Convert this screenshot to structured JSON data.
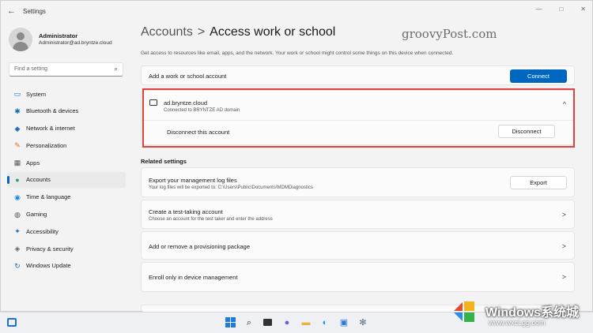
{
  "window": {
    "title": "Settings",
    "back": "←",
    "controls": [
      "—",
      "□",
      "✕"
    ]
  },
  "user": {
    "name": "Administrator",
    "email": "Administrator@ad.bryntze.cloud"
  },
  "search": {
    "placeholder": "Find a setting",
    "icon": "⌕"
  },
  "nav": [
    {
      "label": "System",
      "icon": "monitor-icon",
      "glyph": "▭",
      "color": "#0a6cbd"
    },
    {
      "label": "Bluetooth & devices",
      "icon": "bluetooth-icon",
      "glyph": "✱",
      "color": "#0a6cbd"
    },
    {
      "label": "Network & internet",
      "icon": "wifi-icon",
      "glyph": "◆",
      "color": "#2a6fc4"
    },
    {
      "label": "Personalization",
      "icon": "brush-icon",
      "glyph": "✎",
      "color": "#d06a28"
    },
    {
      "label": "Apps",
      "icon": "apps-icon",
      "glyph": "▦",
      "color": "#555555"
    },
    {
      "label": "Accounts",
      "icon": "person-icon",
      "glyph": "●",
      "color": "#2aa06b",
      "active": true
    },
    {
      "label": "Time & language",
      "icon": "globe-icon",
      "glyph": "◉",
      "color": "#1a8ad6"
    },
    {
      "label": "Gaming",
      "icon": "gamepad-icon",
      "glyph": "◍",
      "color": "#555555"
    },
    {
      "label": "Accessibility",
      "icon": "accessibility-icon",
      "glyph": "✦",
      "color": "#1a6fb8"
    },
    {
      "label": "Privacy & security",
      "icon": "shield-icon",
      "glyph": "◈",
      "color": "#666666"
    },
    {
      "label": "Windows Update",
      "icon": "update-icon",
      "glyph": "↻",
      "color": "#1a6fb8"
    }
  ],
  "header": {
    "parent": "Accounts",
    "separator": ">",
    "title": "Access work or school",
    "description": "Get access to resources like email, apps, and the network. Your work or school might control some things on this device when connected."
  },
  "watermark_top": "groovyPost.com",
  "add_account": {
    "label": "Add a work or school account",
    "button": "Connect"
  },
  "account": {
    "name": "ad.bryntze.cloud",
    "subtitle": "Connected to BRYNTZE AD domain",
    "chevron": "^",
    "disconnect_label": "Disconnect this account",
    "disconnect_button": "Disconnect"
  },
  "related": {
    "title": "Related settings",
    "items": [
      {
        "title": "Export your management log files",
        "sub": "Your log files will be exported to: C:\\Users\\Public\\Documents\\MDMDiagnostics",
        "button": "Export"
      },
      {
        "title": "Create a test-taking account",
        "sub": "Choose an account for the test taker and enter the address",
        "chevron": ">"
      },
      {
        "title": "Add or remove a provisioning package",
        "chevron": ">"
      },
      {
        "title": "Enroll only in device management",
        "chevron": ">"
      }
    ]
  },
  "taskbar": {
    "icons": [
      "start-icon",
      "search-icon",
      "task-view-icon",
      "chat-icon",
      "file-explorer-icon",
      "edge-icon",
      "store-icon",
      "settings-icon"
    ]
  },
  "watermark_bottom": {
    "brand": "Windows系统城",
    "url": "www.wxcLgg.com"
  }
}
